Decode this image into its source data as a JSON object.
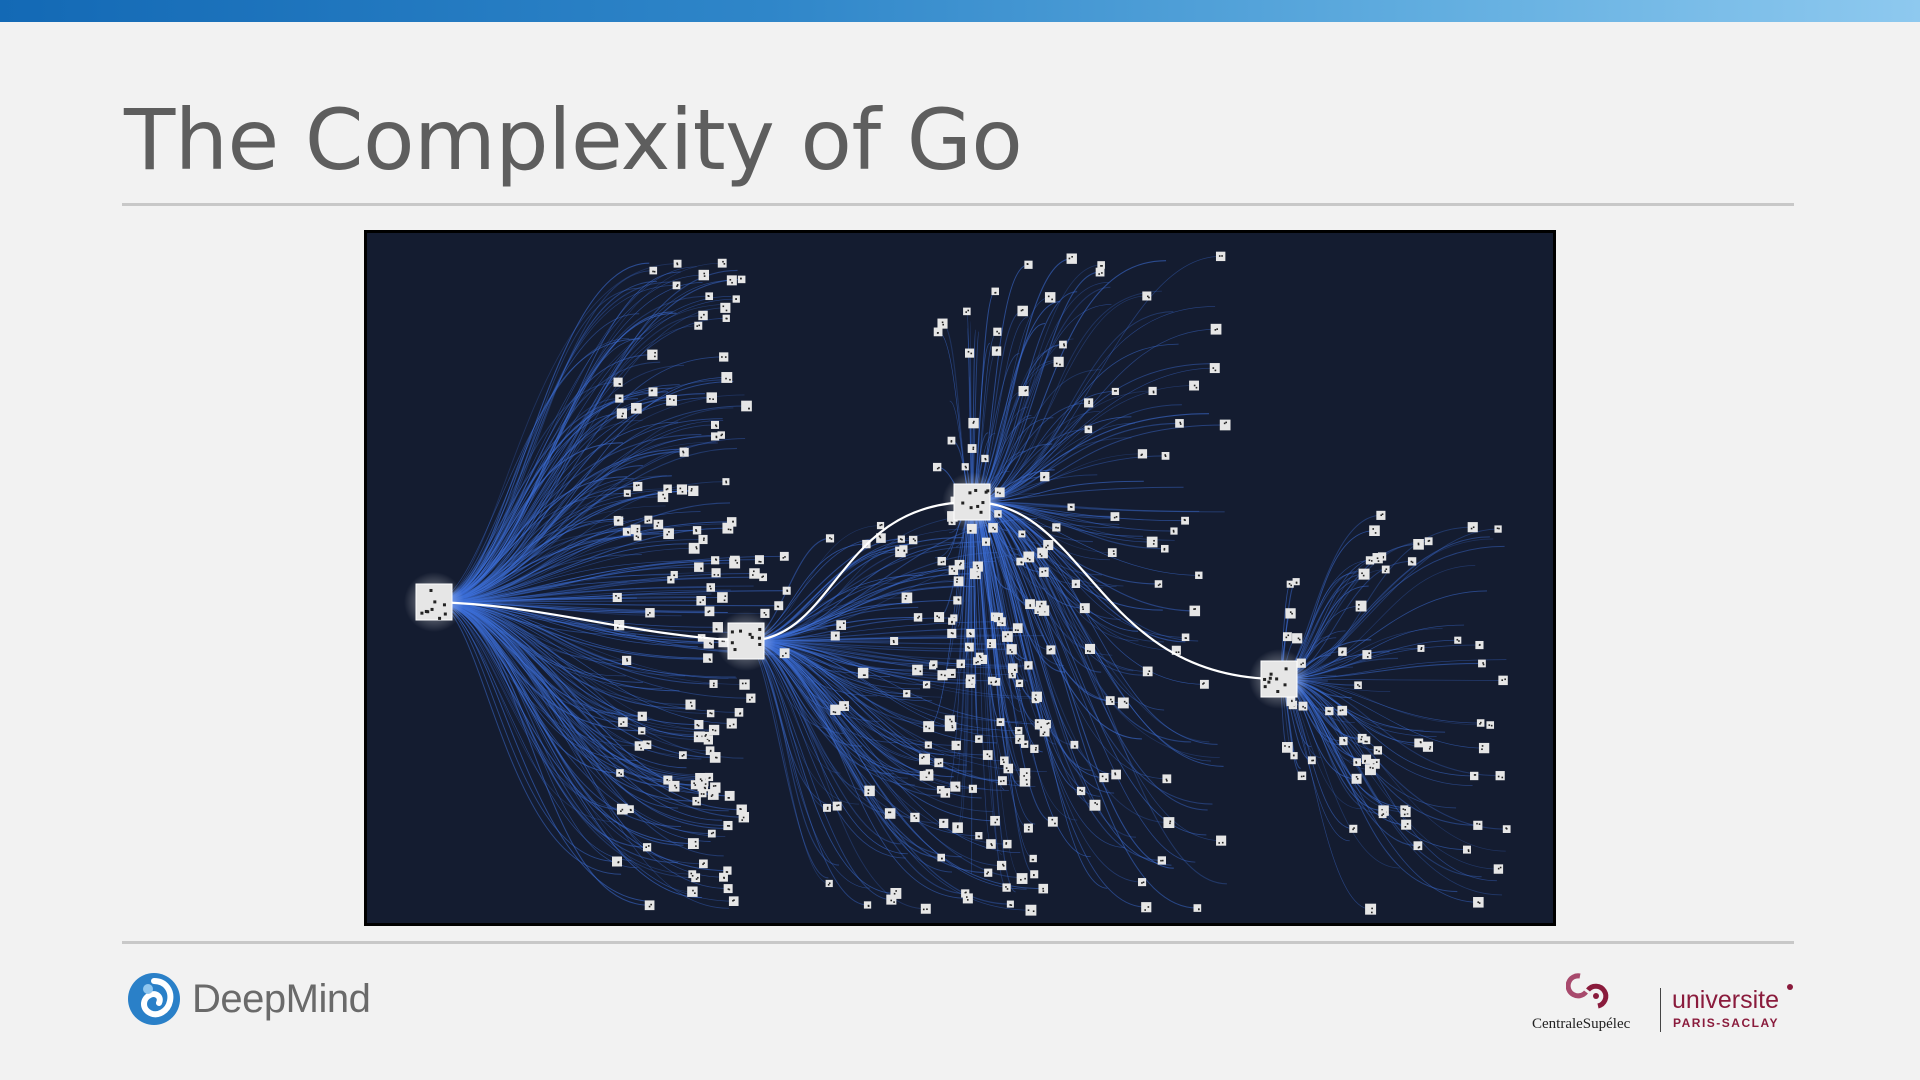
{
  "slide": {
    "title": "The Complexity of Go"
  },
  "figure": {
    "background_color": "#141c30",
    "link_color": "#3d6fd8",
    "path_color": "#ffffff",
    "node_color": "#e6e6e6"
  },
  "footer": {
    "left_logo": {
      "text": "DeepMind",
      "icon": "deepmind-swirl-icon",
      "color": "#2a80c8"
    },
    "right_logo": {
      "centrale_text": "CentraleSupélec",
      "centrale_icon": "centralesupelec-mark-icon",
      "universite_text": "universite",
      "universite_sub": "PARIS-SACLAY",
      "color": "#8a1b3c"
    }
  }
}
